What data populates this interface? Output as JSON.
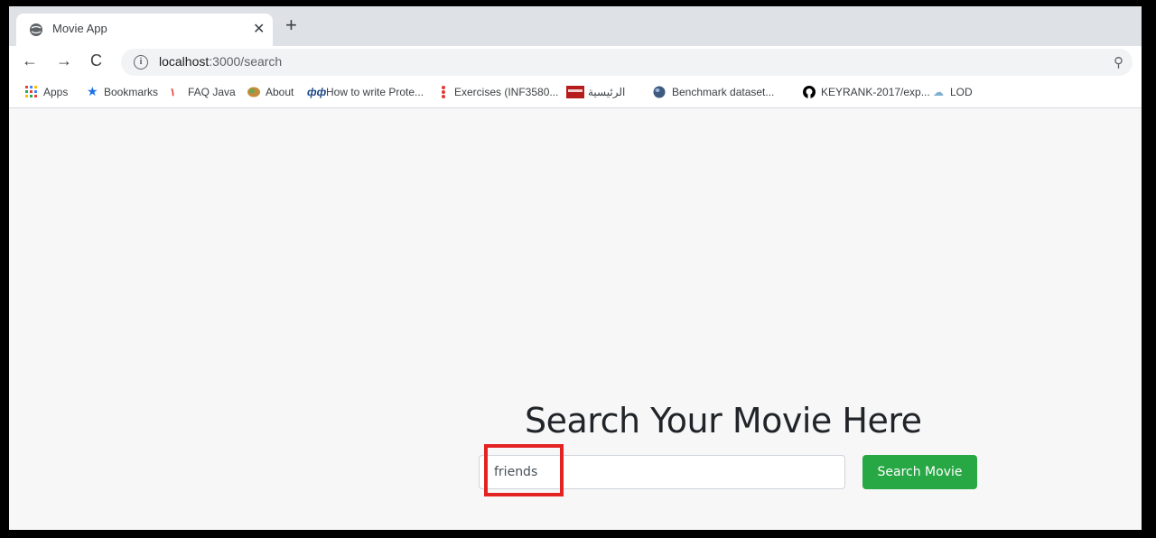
{
  "browser": {
    "tab_title": "Movie App",
    "tab_close": "✕",
    "new_tab": "+",
    "url_host": "localhost",
    "url_path": ":3000/search",
    "bookmarks": [
      {
        "label": "Apps",
        "icon": "apps-grid-icon"
      },
      {
        "label": "Bookmarks",
        "icon": "star-icon"
      },
      {
        "label": "FAQ Java",
        "icon": "java-icon"
      },
      {
        "label": "About",
        "icon": "brain-icon"
      },
      {
        "label": "How to write Prote...",
        "icon": "protege-icon"
      },
      {
        "label": "Exercises (INF3580...",
        "icon": "exercises-icon"
      },
      {
        "label": "الرئيسية",
        "icon": "arabic-site-icon"
      },
      {
        "label": "Benchmark dataset...",
        "icon": "globe-icon"
      },
      {
        "label": "KEYRANK-2017/exp...",
        "icon": "github-icon"
      },
      {
        "label": "LOD",
        "icon": "lod-icon"
      }
    ]
  },
  "page": {
    "heading": "Search Your Movie Here",
    "search_value": "friends",
    "search_button": "Search Movie"
  },
  "colors": {
    "accent_button": "#28a745",
    "highlight_box": "#e32222"
  }
}
